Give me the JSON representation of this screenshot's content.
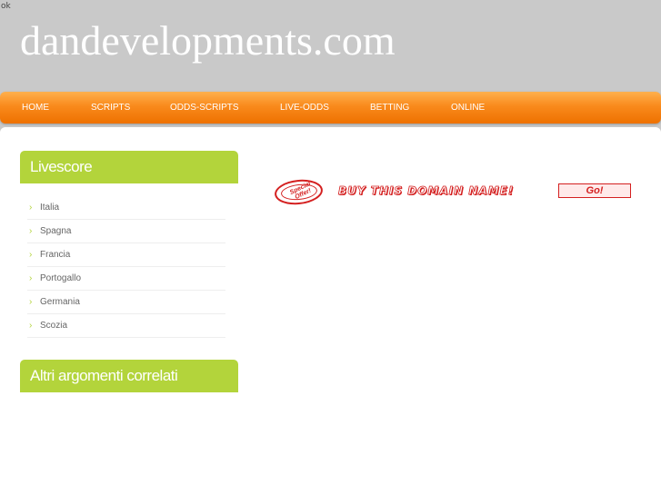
{
  "page": {
    "status_text": "ok",
    "site_title": "dandevelopments.com"
  },
  "nav": {
    "items": [
      {
        "label": "HOME"
      },
      {
        "label": "SCRIPTS"
      },
      {
        "label": "ODDS-SCRIPTS"
      },
      {
        "label": "LIVE-ODDS"
      },
      {
        "label": "BETTING"
      },
      {
        "label": "ONLINE"
      }
    ]
  },
  "sidebar": {
    "livescore_title": "Livescore",
    "livescore_items": [
      {
        "label": "Italia"
      },
      {
        "label": "Spagna"
      },
      {
        "label": "Francia"
      },
      {
        "label": "Portogallo"
      },
      {
        "label": "Germania"
      },
      {
        "label": "Scozia"
      }
    ],
    "related_title": "Altri argomenti correlati"
  },
  "offer": {
    "stamp_text": "Special Offer!",
    "buy_text": "BUY THIS DOMAIN NAME!",
    "go_label": "Go!"
  },
  "colors": {
    "nav_orange": "#f98a1c",
    "sidebar_green": "#b3d43b",
    "offer_red": "#d42020",
    "header_gray": "#c9c9c9"
  }
}
